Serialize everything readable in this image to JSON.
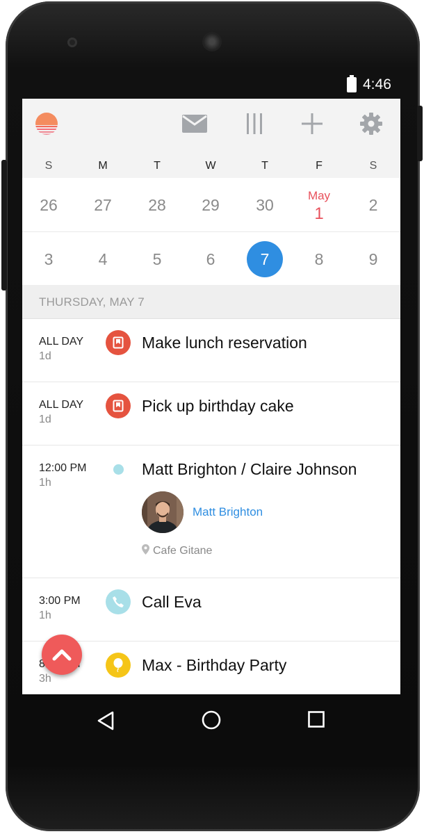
{
  "status_bar": {
    "time": "4:46"
  },
  "toolbar": {
    "icons": [
      "sunrise-logo-icon",
      "mail-icon",
      "columns-icon",
      "add-icon",
      "settings-icon"
    ]
  },
  "calendar": {
    "weekdays": [
      "S",
      "M",
      "T",
      "W",
      "T",
      "F",
      "S"
    ],
    "week1": [
      "26",
      "27",
      "28",
      "29",
      "30",
      "1",
      "2"
    ],
    "week1_month_label": "May",
    "week2": [
      "3",
      "4",
      "5",
      "6",
      "7",
      "8",
      "9"
    ],
    "selected_day": "7",
    "colors": {
      "accent": "#2f8ee1",
      "month_start": "#e8505b"
    }
  },
  "agenda": {
    "day_header": "THURSDAY, MAY 7",
    "events": [
      {
        "time": "ALL DAY",
        "duration": "1d",
        "title": "Make lunch reservation",
        "icon": "reminder-icon",
        "color": "#e5533f"
      },
      {
        "time": "ALL DAY",
        "duration": "1d",
        "title": "Pick up birthday cake",
        "icon": "reminder-icon",
        "color": "#e5533f"
      },
      {
        "time": "12:00 PM",
        "duration": "1h",
        "title": "Matt Brighton / Claire Johnson",
        "icon": "event-dot-icon",
        "color": "#a8dfe8",
        "attendee": "Matt Brighton",
        "location": "Cafe Gitane"
      },
      {
        "time": "3:00 PM",
        "duration": "1h",
        "title": "Call Eva",
        "icon": "phone-icon",
        "color": "#a8dfe8"
      },
      {
        "time": "8:00 PM",
        "duration": "3h",
        "title": "Max - Birthday Party",
        "icon": "balloon-icon",
        "color": "#f5c518"
      }
    ]
  },
  "fab": {
    "icon": "chevron-up-icon",
    "color": "#ef5a5a"
  },
  "navigation": {
    "icons": [
      "back-icon",
      "home-icon",
      "recents-icon"
    ]
  }
}
